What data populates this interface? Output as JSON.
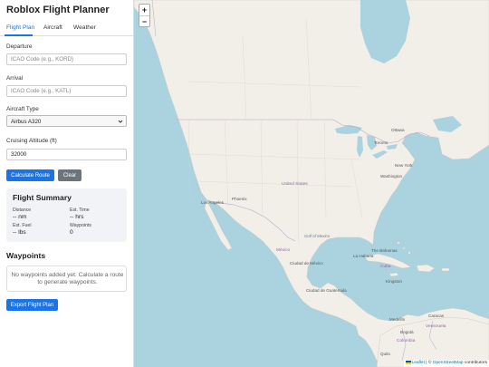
{
  "app": {
    "title": "Roblox Flight Planner"
  },
  "tabs": [
    {
      "label": "Flight Plan",
      "active": true
    },
    {
      "label": "Aircraft",
      "active": false
    },
    {
      "label": "Weather",
      "active": false
    }
  ],
  "form": {
    "departure": {
      "label": "Departure",
      "value": "",
      "placeholder": "ICAO Code (e.g., KORD)"
    },
    "arrival": {
      "label": "Arrival",
      "value": "",
      "placeholder": "ICAO Code (e.g., KATL)"
    },
    "aircraft_type": {
      "label": "Aircraft Type",
      "selected": "Airbus A320"
    },
    "cruising_altitude": {
      "label": "Cruising Altitude (ft)",
      "value": "32000"
    }
  },
  "buttons": {
    "calculate": "Calculate Route",
    "clear": "Clear",
    "export": "Export Flight Plan"
  },
  "summary": {
    "title": "Flight Summary",
    "distance": {
      "label": "Distance",
      "value": "-- nm"
    },
    "est_time": {
      "label": "Est. Time",
      "value": "-- hrs"
    },
    "est_fuel": {
      "label": "Est. Fuel",
      "value": "-- lbs"
    },
    "waypoints": {
      "label": "Waypoints",
      "value": "0"
    }
  },
  "waypoints_section": {
    "title": "Waypoints",
    "empty_message": "No waypoints added yet. Calculate a route to generate waypoints."
  },
  "map": {
    "zoom_in": "+",
    "zoom_out": "−",
    "attribution": {
      "leaflet": "Leaflet",
      "separator": " | © ",
      "osm": "OpenStreetMap",
      "contributors": " contributors"
    },
    "labels": {
      "ottawa": "Ottawa",
      "toronto": "Toronto",
      "new_york": "New York",
      "washington": "Washington",
      "united_states": "United States",
      "los_angeles": "Los Angeles",
      "phoenix": "Phoenix",
      "mexico": "México",
      "ciudad_mexico": "Ciudad de México",
      "la_habana": "La Habana",
      "cuba": "Cuba",
      "kingston": "Kingston",
      "guatemala": "Ciudad de Guatemala",
      "caracas": "Caracas",
      "venezuela": "Venezuela",
      "colombia": "Colombia",
      "medellin": "Medellín",
      "bogota": "Bogotá",
      "quito": "Quito",
      "the_bahamas": "The Bahamas",
      "gulf": "Gulf of Mexico"
    },
    "colors": {
      "water": "#aad3df",
      "land": "#f2efe9",
      "border": "#b9a8c6",
      "accent": "#1a73e8"
    }
  }
}
